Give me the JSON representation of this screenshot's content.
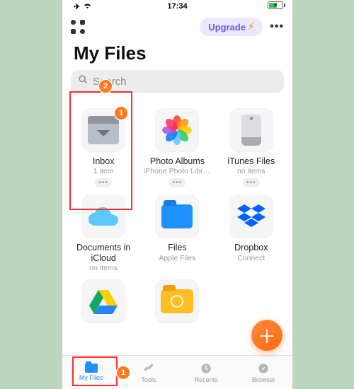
{
  "status": {
    "time": "17:34"
  },
  "header": {
    "upgrade_label": "Upgrade",
    "title": "My Files"
  },
  "search": {
    "placeholder": "Search"
  },
  "tiles": [
    {
      "name": "Inbox",
      "sub": "1 item",
      "kind": "inbox",
      "dots": true
    },
    {
      "name": "Photo Albums",
      "sub": "iPhone Photo Libra...",
      "kind": "photos",
      "dots": true
    },
    {
      "name": "iTunes Files",
      "sub": "no items",
      "kind": "itunes",
      "dots": true
    },
    {
      "name": "Documents in iCloud",
      "sub": "no items",
      "kind": "icloud",
      "dots": false
    },
    {
      "name": "Files",
      "sub": "Apple Files",
      "kind": "files",
      "dots": false
    },
    {
      "name": "Dropbox",
      "sub": "Connect",
      "kind": "dropbox",
      "dots": false
    },
    {
      "name": "",
      "sub": "",
      "kind": "drive",
      "dots": false
    },
    {
      "name": "",
      "sub": "",
      "kind": "folder2",
      "dots": false
    }
  ],
  "tabs": [
    {
      "label": "My Files",
      "icon": "folder",
      "active": true
    },
    {
      "label": "Tools",
      "icon": "tools",
      "active": false
    },
    {
      "label": "Recents",
      "icon": "recents",
      "active": false
    },
    {
      "label": "Browser",
      "icon": "browser",
      "active": false
    }
  ],
  "annotations": {
    "badge1": "1",
    "badge2": "2",
    "badge_tab": "1"
  }
}
